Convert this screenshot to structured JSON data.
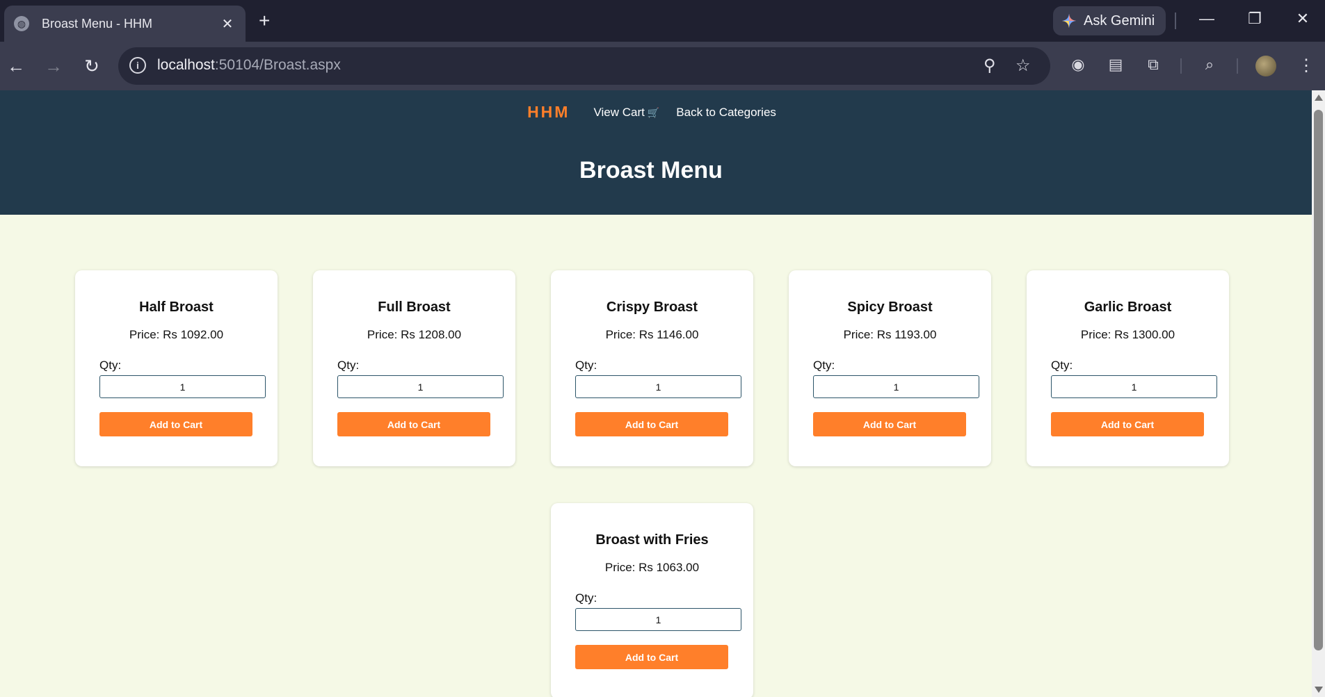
{
  "browser": {
    "tab_title": "Broast Menu - HHM",
    "url_host": "localhost",
    "url_path": ":50104/Broast.aspx",
    "gemini_label": "Ask Gemini"
  },
  "site": {
    "brand": "HHM",
    "nav": {
      "view_cart": "View Cart",
      "back": "Back to Categories"
    },
    "title": "Broast Menu"
  },
  "labels": {
    "qty": "Qty:",
    "add_to_cart": "Add to Cart"
  },
  "products": [
    {
      "name": "Half Broast",
      "price": "Price: Rs 1092.00",
      "qty": "1"
    },
    {
      "name": "Full Broast",
      "price": "Price: Rs 1208.00",
      "qty": "1"
    },
    {
      "name": "Crispy Broast",
      "price": "Price: Rs 1146.00",
      "qty": "1"
    },
    {
      "name": "Spicy Broast",
      "price": "Price: Rs 1193.00",
      "qty": "1"
    },
    {
      "name": "Garlic Broast",
      "price": "Price: Rs 1300.00",
      "qty": "1"
    },
    {
      "name": "Broast with Fries",
      "price": "Price: Rs 1063.00",
      "qty": "1"
    }
  ],
  "colors": {
    "header_bg": "#223a4c",
    "accent": "#ff7f2a",
    "page_bg": "#f5f9e6"
  }
}
